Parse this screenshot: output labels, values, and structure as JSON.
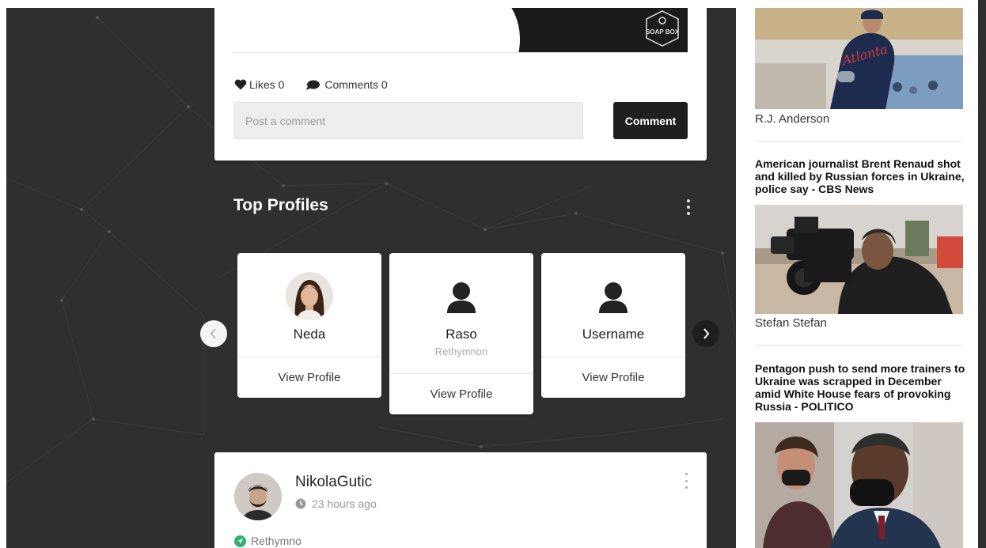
{
  "post": {
    "likes_label": "Likes 0",
    "comments_label": "Comments 0",
    "comment_placeholder": "Post a comment",
    "comment_button": "Comment",
    "soapbox_logo_text": "SOAP BOX"
  },
  "top_profiles": {
    "title": "Top Profiles",
    "cards": [
      {
        "name": "Neda",
        "location": "",
        "view_label": "View Profile"
      },
      {
        "name": "Raso",
        "location": "Rethymnon",
        "view_label": "View Profile"
      },
      {
        "name": "Username",
        "location": "",
        "view_label": "View Profile"
      }
    ]
  },
  "post2": {
    "username": "NikolaGutic",
    "time": "23 hours ago",
    "location": "Rethymno"
  },
  "sidebar": {
    "news": [
      {
        "author": "R.J. Anderson",
        "title": ""
      },
      {
        "title": "American journalist Brent Renaud shot and killed by Russian forces in Ukraine, police say - CBS News",
        "author": "Stefan Stefan"
      },
      {
        "title": "Pentagon push to send more trainers to Ukraine was scrapped in December amid White House fears of provoking Russia - POLITICO",
        "author": ""
      }
    ]
  },
  "colors": {
    "background": "#2f2f2f",
    "button_dark": "#1f1f1f",
    "location_pin": "#2db36b"
  }
}
